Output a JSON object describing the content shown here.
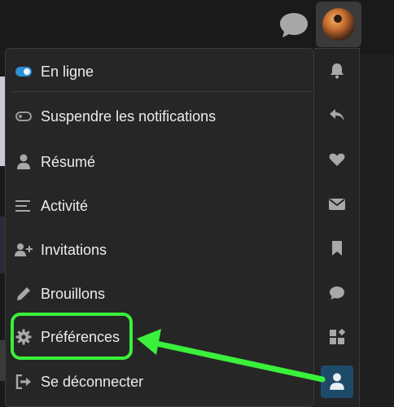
{
  "header": {
    "chat_icon": "chat-bubble-icon",
    "avatar_alt": "user-avatar"
  },
  "menu": {
    "status_items": [
      {
        "label": "En ligne",
        "icon": "toggle-on-icon",
        "state": "on"
      },
      {
        "label": "Suspendre les notifications",
        "icon": "toggle-off-icon",
        "state": "off"
      }
    ],
    "items": [
      {
        "label": "Résumé",
        "icon": "user-icon"
      },
      {
        "label": "Activité",
        "icon": "list-icon"
      },
      {
        "label": "Invitations",
        "icon": "user-plus-icon"
      },
      {
        "label": "Brouillons",
        "icon": "pencil-icon"
      },
      {
        "label": "Préférences",
        "icon": "gear-icon",
        "highlighted": true
      },
      {
        "label": "Se déconnecter",
        "icon": "sign-out-icon"
      }
    ]
  },
  "quick_access": [
    {
      "icon": "bell-icon"
    },
    {
      "icon": "reply-icon"
    },
    {
      "icon": "heart-icon"
    },
    {
      "icon": "envelope-icon"
    },
    {
      "icon": "bookmark-icon"
    },
    {
      "icon": "chat-icon"
    },
    {
      "icon": "widgets-icon"
    },
    {
      "icon": "user-icon",
      "active": true
    }
  ],
  "colors": {
    "accent_green": "#39f03a",
    "toggle_blue": "#2d8fd5",
    "active_tab": "#1e4a6a"
  }
}
